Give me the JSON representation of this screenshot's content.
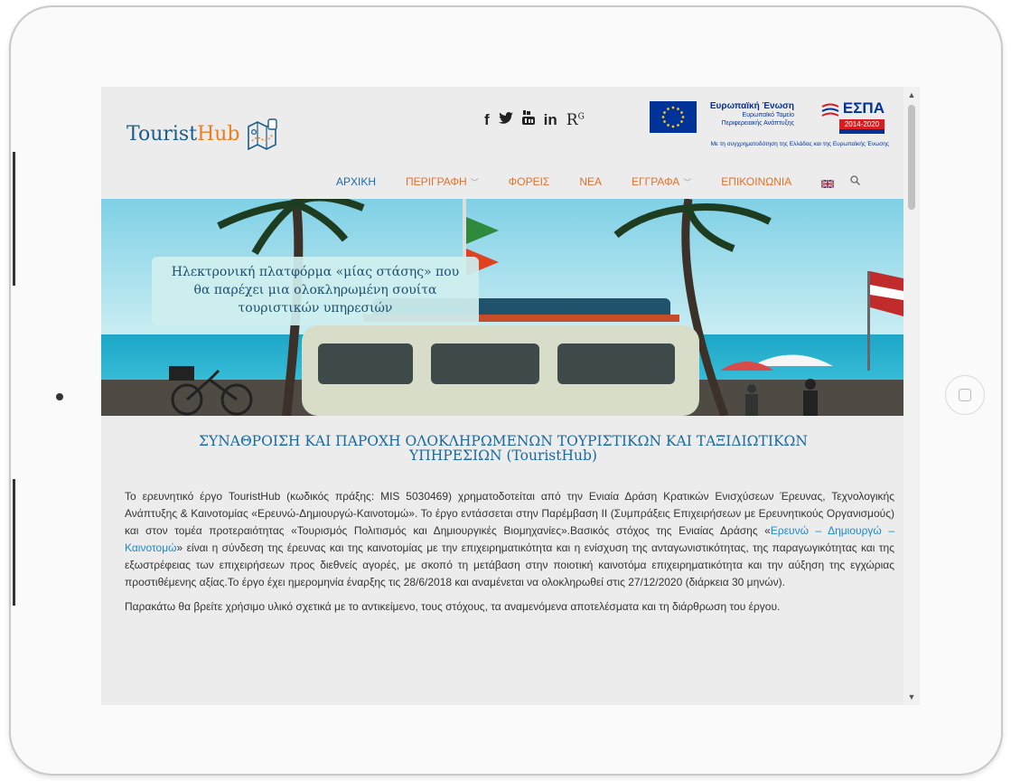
{
  "site": {
    "logo_part1": "Tourist",
    "logo_part2": "Hub",
    "social_icons": [
      "facebook-icon",
      "twitter-icon",
      "youtube-icon",
      "linkedin-icon",
      "researchgate-icon"
    ],
    "social_glyphs": {
      "facebook": "f",
      "linkedin": "in",
      "researchgate": "R",
      "researchgate_sup": "G"
    }
  },
  "eu_banner": {
    "title": "Ευρωπαϊκή Ένωση",
    "fund_line1": "Ευρωπαϊκό Ταμείο",
    "fund_line2": "Περιφερειακής Ανάπτυξης",
    "espa": "ΕΣΠΑ",
    "espa_years": "2014-2020",
    "caption": "Με τη συγχρηματοδότηση της Ελλάδας και της Ευρωπαϊκής Ένωσης"
  },
  "nav": {
    "items": [
      {
        "label": "ΑΡΧΙΚΗ",
        "active": true
      },
      {
        "label": "ΠΕΡΙΓΡΑΦΗ",
        "has_dropdown": true
      },
      {
        "label": "ΦΟΡΕΙΣ"
      },
      {
        "label": "ΝΕΑ"
      },
      {
        "label": "ΕΓΓΡΑΦΑ",
        "has_dropdown": true
      },
      {
        "label": "ΕΠΙΚΟΙΝΩΝΙΑ"
      }
    ],
    "language_icon": "uk-flag-icon",
    "search_icon": "search-icon"
  },
  "hero": {
    "caption_line1": "Ηλεκτρονική πλατφόρμα «μίας στάσης» που",
    "caption_line2": "θα παρέχει μια ολοκληρωμένη σουίτα",
    "caption_line3": "τουριστικών υπηρεσιών"
  },
  "main": {
    "title_line1": "ΣΥΝΑΘΡΟΙΣΗ ΚΑΙ ΠΑΡΟΧΗ ΟΛΟΚΛΗΡΩΜΕΝΩΝ ΤΟΥΡΙΣΤΙΚΩΝ ΚΑΙ ΤΑΞΙΔΙΩΤΙΚΩΝ",
    "title_line2": "ΥΠΗΡΕΣΙΩΝ (TouristHub)",
    "p1_before_link": "Το ερευνητικό έργο TouristHub (κωδικός πράξης: MIS 5030469) χρηματοδοτείται από την Ενιαία Δράση Κρατικών Ενισχύσεων Έρευνας, Τεχνολογικής Ανάπτυξης & Καινοτομίας «Ερευνώ-Δημιουργώ-Καινοτομώ». Το έργο εντάσσεται στην Παρέμβαση ΙΙ (Συμπράξεις Επιχειρήσεων με Ερευνητικούς Οργανισμούς) και στον τομέα προτεραιότητας «Τουρισμός Πολιτισμός και Δημιουργικές Βιομηχανίες».Βασικός στόχος της Ενιαίας Δράσης «",
    "p1_link": "Ερευνώ – Δημιουργώ – Καινοτομώ",
    "p1_after_link": "» είναι η σύνδεση της έρευνας και της καινοτομίας με την επιχειρηματικότητα και η ενίσχυση της ανταγωνιστικότητας, της παραγωγικότητας και της εξωστρέφειας των επιχειρήσεων προς διεθνείς αγορές, με σκοπό τη μετάβαση στην ποιοτική καινοτόμα επιχειρηματικότητα και την αύξηση της εγχώριας προστιθέμενης αξίας.Το έργο έχει ημερομηνία έναρξης τις 28/6/2018 και αναμένεται να ολοκληρωθεί στις 27/12/2020 (διάρκεια 30 μηνών).",
    "p2": "Παρακάτω θα βρείτε χρήσιμο υλικό σχετικά με το αντικείμενο, τους στόχους, τα αναμενόμενα αποτελέσματα και τη διάρθρωση του έργου."
  },
  "colors": {
    "brand_blue": "#1c5c86",
    "brand_orange": "#e77e22",
    "nav_active": "#1a6aa7",
    "nav_item": "#e0712b",
    "link": "#1a8acb"
  }
}
